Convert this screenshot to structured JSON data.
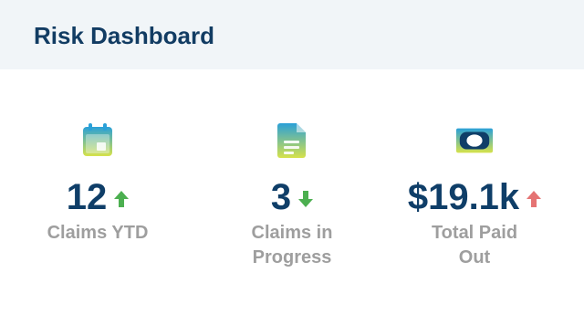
{
  "header": {
    "title": "Risk Dashboard"
  },
  "colors": {
    "title": "#123c63",
    "value": "#0f3e68",
    "label": "#9e9e9e",
    "trend_up_good": "#4caf50",
    "trend_down": "#4caf50",
    "trend_up_bad": "#e57373",
    "icon_gradient_top": "#2aa0d8",
    "icon_gradient_bottom": "#d6e24a"
  },
  "stats": [
    {
      "icon": "calendar-icon",
      "value": "12",
      "trend": "up",
      "label": "Claims YTD"
    },
    {
      "icon": "document-icon",
      "value": "3",
      "trend": "down",
      "label": "Claims in Progress"
    },
    {
      "icon": "cash-icon",
      "value": "$19.1k",
      "trend": "up",
      "label": "Total Paid Out"
    }
  ]
}
